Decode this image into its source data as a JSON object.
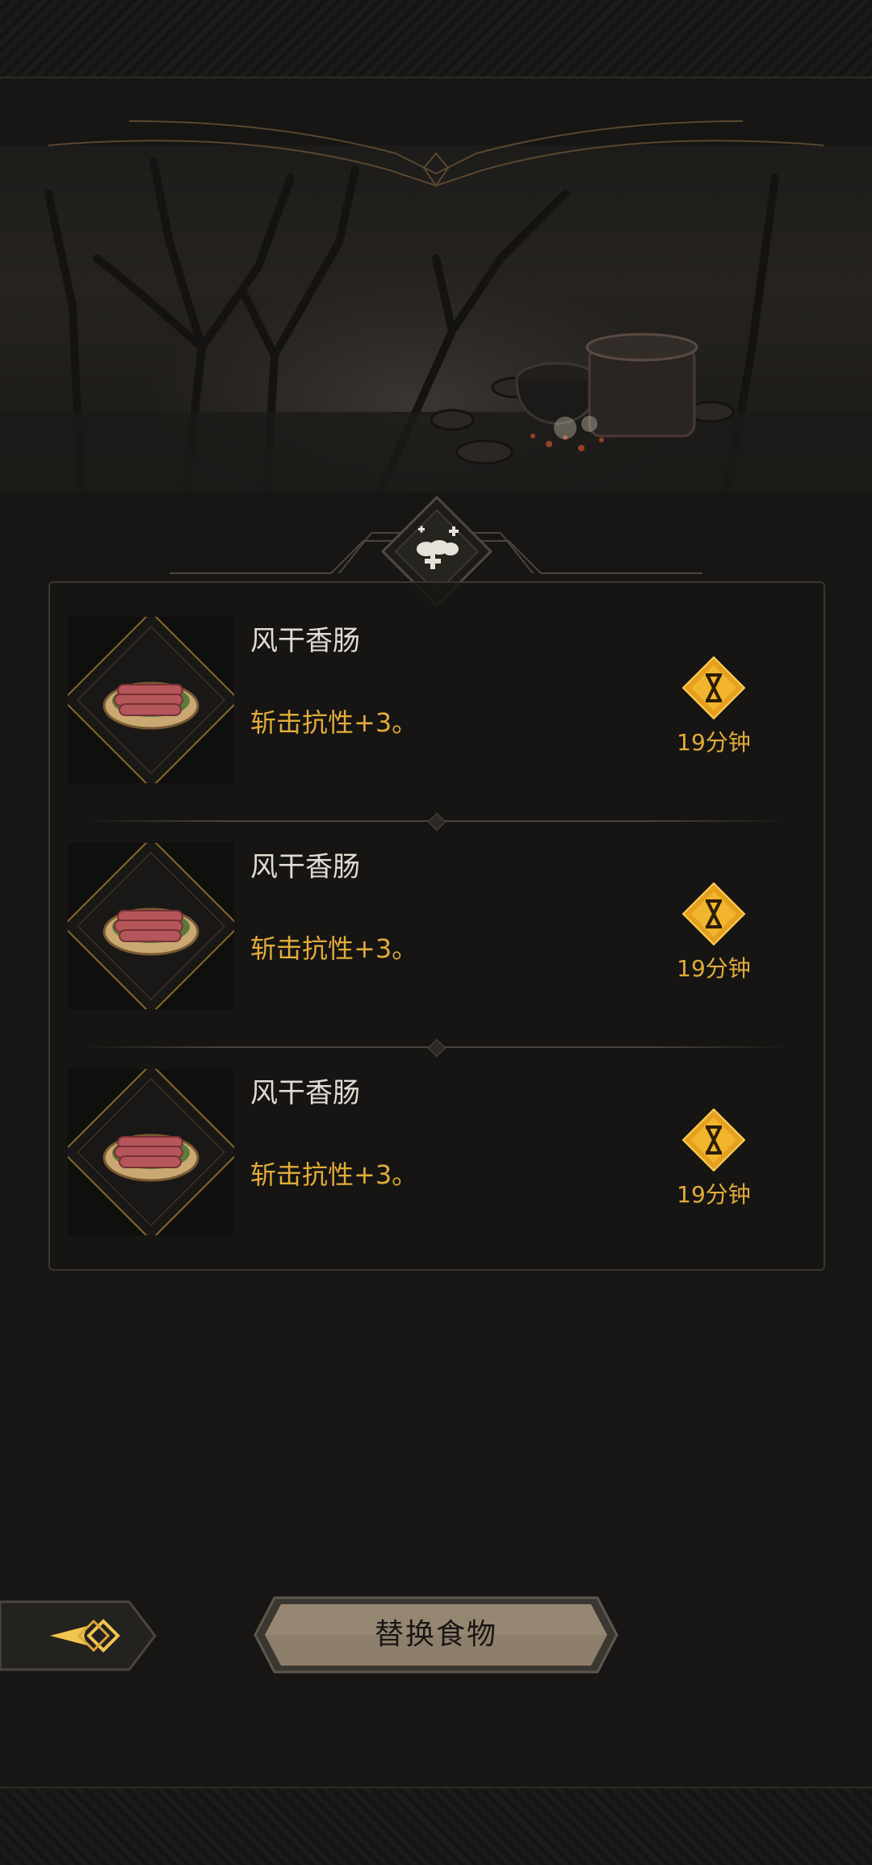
{
  "header": {
    "emblem_icon": "ornate-crest-icon"
  },
  "scene": {
    "description_icon": "campfire-cooking-pot-scene"
  },
  "panel": {
    "badge_icon": "food-buff-plus-icon",
    "items": [
      {
        "name": "风干香肠",
        "effect": "斩击抗性+3。",
        "duration": "19分钟",
        "icon": "sausage-plate-icon",
        "duration_icon": "hourglass-icon"
      },
      {
        "name": "风干香肠",
        "effect": "斩击抗性+3。",
        "duration": "19分钟",
        "icon": "sausage-plate-icon",
        "duration_icon": "hourglass-icon"
      },
      {
        "name": "风干香肠",
        "effect": "斩击抗性+3。",
        "duration": "19分钟",
        "icon": "sausage-plate-icon",
        "duration_icon": "hourglass-icon"
      }
    ]
  },
  "footer": {
    "back_icon": "back-arrow-icon",
    "replace_label": "替换食物"
  },
  "colors": {
    "accent_gold": "#e2ac3a",
    "text_light": "#e1dcd2",
    "background": "#171614",
    "button_fill": "#8e7f6c"
  }
}
